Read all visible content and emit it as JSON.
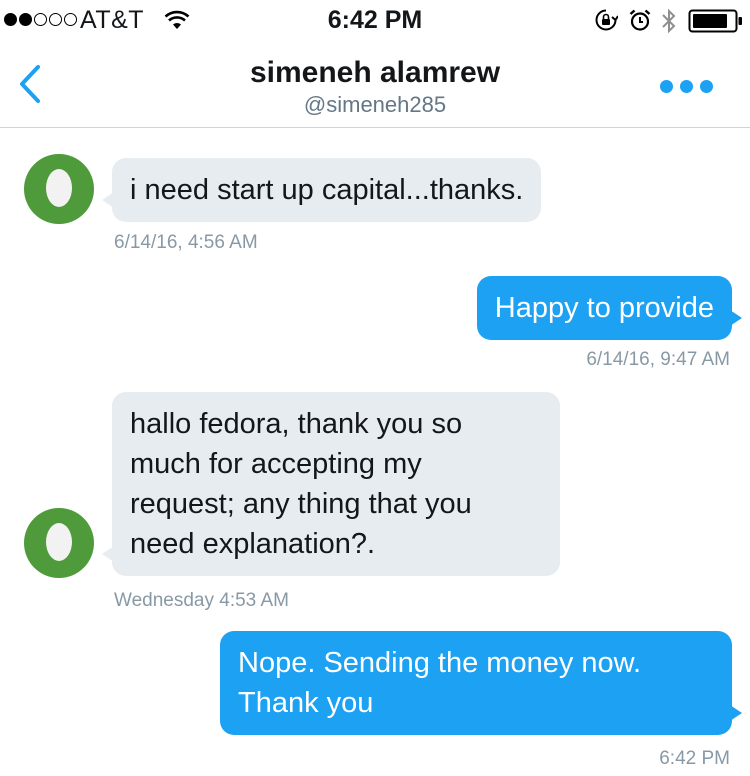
{
  "status_bar": {
    "carrier": "AT&T",
    "time": "6:42 PM",
    "signal_dots": [
      true,
      true,
      false,
      false,
      false
    ]
  },
  "header": {
    "name": "simeneh alamrew",
    "handle": "@simeneh285",
    "back_icon": "chevron-left-icon",
    "more_icon": "more-dots-icon"
  },
  "colors": {
    "accent": "#1da1f2",
    "incoming_bubble": "#e6ecf0",
    "avatar": "#4f9a3a"
  },
  "messages": [
    {
      "direction": "in",
      "lines": [
        "i need start up capital...thanks."
      ],
      "timestamp": "6/14/16, 4:56 AM"
    },
    {
      "direction": "out",
      "lines": [
        "Happy to provide"
      ],
      "timestamp": "6/14/16, 9:47 AM"
    },
    {
      "direction": "in",
      "lines": [
        "hallo fedora, thank you so",
        "much for accepting my",
        "request; any thing that you",
        "need explanation?."
      ],
      "timestamp": "Wednesday 4:53 AM"
    },
    {
      "direction": "out",
      "lines": [
        "Nope. Sending the money now.",
        "Thank you"
      ],
      "timestamp": "6:42 PM"
    }
  ]
}
